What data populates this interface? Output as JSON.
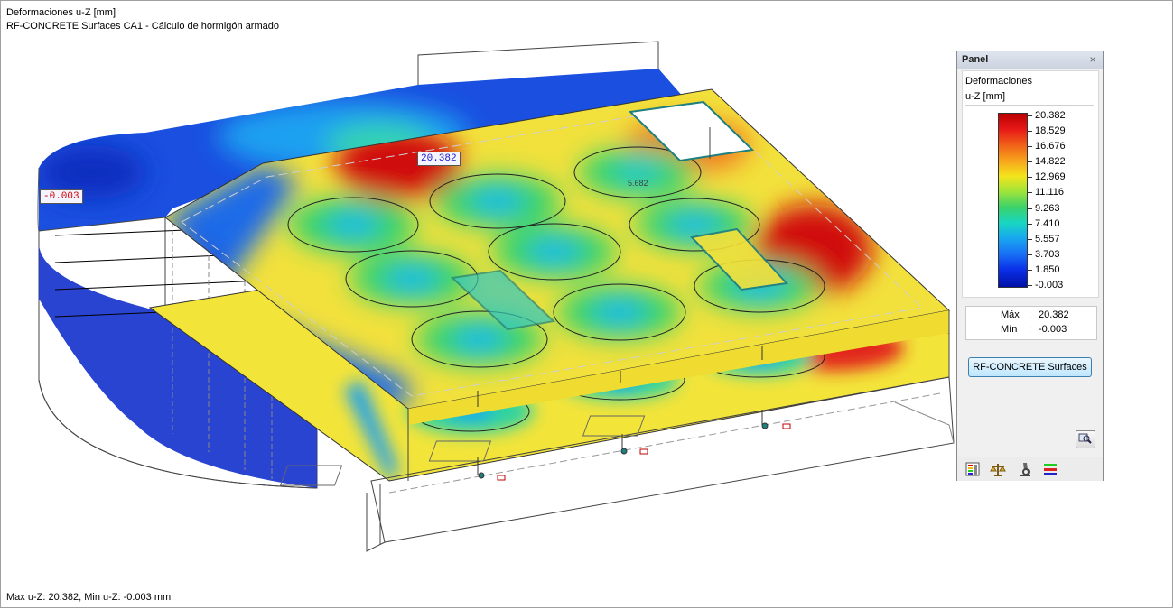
{
  "view": {
    "title_line1": "Deformaciones u-Z [mm]",
    "title_line2": "RF-CONCRETE Surfaces CA1 - Cálculo de hormigón armado",
    "footer": "Max u-Z: 20.382, Min u-Z: -0.003 mm",
    "max_flag": "20.382",
    "min_flag": "-0.003",
    "inner_value": "5.682"
  },
  "panel": {
    "title": "Panel",
    "close_glyph": "×",
    "legend_heading": "Deformaciones",
    "legend_unit": "u-Z [mm]",
    "legend_values": [
      "20.382",
      "18.529",
      "16.676",
      "14.822",
      "12.969",
      "11.116",
      "9.263",
      "7.410",
      "5.557",
      "3.703",
      "1.850",
      "-0.003"
    ],
    "legend_colors": [
      "#bb0000",
      "#e81818",
      "#f06018",
      "#f7a21c",
      "#f4e41c",
      "#9fe43a",
      "#3bd26a",
      "#18d6c2",
      "#18a6f0",
      "#1870f5",
      "#0a30e8",
      "#0010a8"
    ],
    "max_label": "Máx",
    "max_value": "20.382",
    "min_label": "Mín",
    "min_value": "-0.003",
    "button_label": "RF-CONCRETE Surfaces",
    "tabs": [
      "color-scale-icon",
      "balance-icon",
      "microscope-icon",
      "lines-icon"
    ],
    "zoom_icon": "zoom-icon"
  }
}
